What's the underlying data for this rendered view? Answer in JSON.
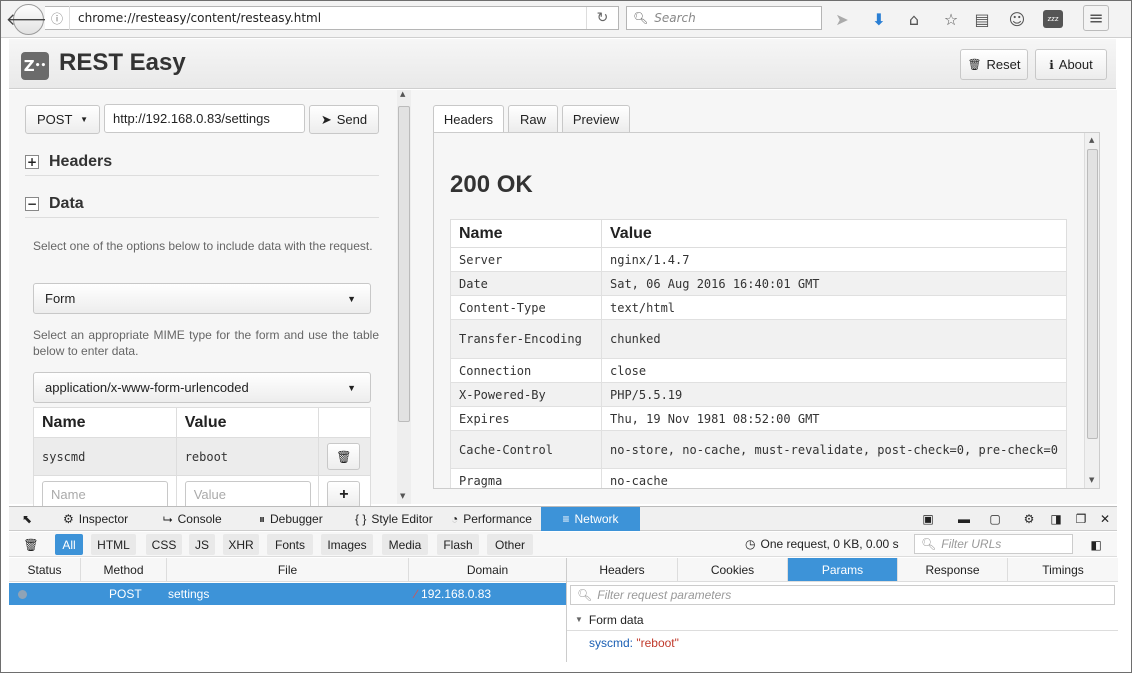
{
  "browser": {
    "url": "chrome://resteasy/content/resteasy.html",
    "search_placeholder": "Search"
  },
  "app": {
    "title": "REST Easy",
    "logo_text": "Z",
    "reset_label": "Reset",
    "about_label": "About"
  },
  "request": {
    "method": "POST",
    "url": "http://192.168.0.83/settings",
    "send_label": "Send",
    "headers_label": "Headers",
    "data_label": "Data",
    "data_help": "Select one of the options below to include data with the request.",
    "data_type": "Form",
    "mime_help": "Select an appropriate MIME type for the form and use the table below to enter data.",
    "mime_type": "application/x-www-form-urlencoded",
    "form": {
      "col_name": "Name",
      "col_value": "Value",
      "rows": [
        {
          "name": "syscmd",
          "value": "reboot"
        }
      ],
      "name_placeholder": "Name",
      "value_placeholder": "Value"
    }
  },
  "response": {
    "tabs": [
      "Headers",
      "Raw",
      "Preview"
    ],
    "status": "200 OK",
    "col_name": "Name",
    "col_value": "Value",
    "headers": [
      {
        "name": "Server",
        "value": "nginx/1.4.7"
      },
      {
        "name": "Date",
        "value": "Sat, 06 Aug 2016 16:40:01 GMT"
      },
      {
        "name": "Content-Type",
        "value": "text/html"
      },
      {
        "name": "Transfer-Encoding",
        "value": "chunked"
      },
      {
        "name": "Connection",
        "value": "close"
      },
      {
        "name": "X-Powered-By",
        "value": "PHP/5.5.19"
      },
      {
        "name": "Expires",
        "value": "Thu, 19 Nov 1981 08:52:00 GMT"
      },
      {
        "name": "Cache-Control",
        "value": "no-store, no-cache, must-revalidate, post-check=0, pre-check=0"
      },
      {
        "name": "Pragma",
        "value": "no-cache"
      }
    ]
  },
  "devtools": {
    "tabs": [
      "Inspector",
      "Console",
      "Debugger",
      "Style Editor",
      "Performance",
      "Network"
    ],
    "filters": [
      "All",
      "HTML",
      "CSS",
      "JS",
      "XHR",
      "Fonts",
      "Images",
      "Media",
      "Flash",
      "Other"
    ],
    "summary": "One request, 0 KB, 0.00 s",
    "filter_placeholder": "Filter URLs",
    "columns": [
      "Status",
      "Method",
      "File",
      "Domain"
    ],
    "request_row": {
      "method": "POST",
      "file": "settings",
      "domain": "192.168.0.83"
    },
    "side_tabs": [
      "Headers",
      "Cookies",
      "Params",
      "Response",
      "Timings"
    ],
    "params_placeholder": "Filter request parameters",
    "form_data_label": "Form data",
    "param_key": "syscmd:",
    "param_value": "\"reboot\""
  },
  "colors": {
    "accent": "#3d93d8",
    "param_key": "#1a5fb4",
    "param_value": "#c0392b"
  }
}
